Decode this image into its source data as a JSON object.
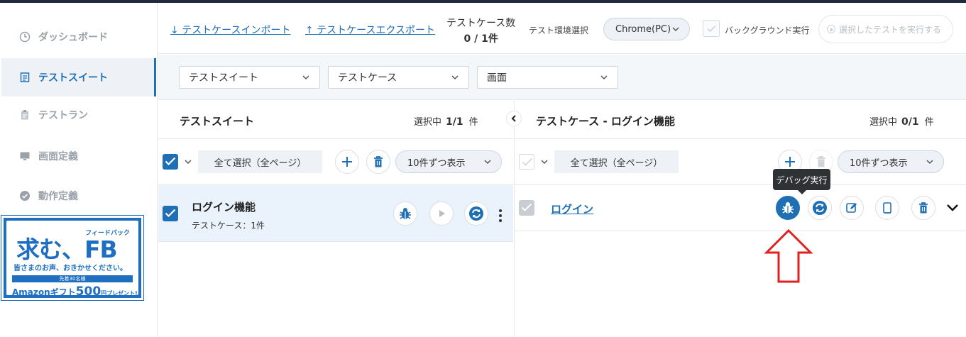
{
  "sidebar": {
    "items": [
      {
        "label": "ダッシュボード",
        "icon": "clock-icon"
      },
      {
        "label": "テストスイート",
        "icon": "list-icon",
        "active": true
      },
      {
        "label": "テストラン",
        "icon": "clipboard-icon"
      },
      {
        "label": "画面定義",
        "icon": "monitor-icon"
      },
      {
        "label": "動作定義",
        "icon": "check-circle-icon"
      }
    ],
    "banner": {
      "title": "求む、FB",
      "tag": "フィードバック",
      "subtitle": "皆さまのお声、おきかせください。",
      "bar": "先着30名様",
      "gift_prefix": "Amazonギフト",
      "gift_amount": "500",
      "gift_suffix": "円プレゼント!"
    }
  },
  "toolbar": {
    "import_label": "↓ テストケースインポート",
    "export_label": "↑ テストケースエクスポート",
    "count_label": "テストケース数",
    "count_value": "0 / 1件",
    "env_label": "テスト環境選択",
    "env_value": "Chrome(PC)",
    "bg_label": "バックグラウンド実行",
    "run_label": "選択したテストを実行する"
  },
  "filters": {
    "suite": "テストスイート",
    "case": "テストケース",
    "screen": "画面"
  },
  "left_panel": {
    "title": "テストスイート",
    "sel_prefix": "選択中",
    "sel_value": "1/1",
    "sel_suffix": "件",
    "select_all": "全て選択（全ページ）",
    "pager": "10件ずつ表示",
    "rows": [
      {
        "name": "ログイン機能",
        "sub": "テストケース：1件"
      }
    ]
  },
  "right_panel": {
    "title": "テストケース - ログイン機能",
    "sel_prefix": "選択中",
    "sel_value": "0/1",
    "sel_suffix": "件",
    "select_all": "全て選択（全ページ）",
    "pager": "10件ずつ表示",
    "rows": [
      {
        "name": "ログイン"
      }
    ]
  },
  "tooltip": "デバッグ実行",
  "colors": {
    "accent": "#1f6fb5",
    "annotation": "#e02020"
  }
}
